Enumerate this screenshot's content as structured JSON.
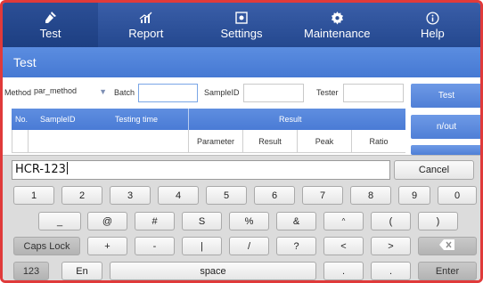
{
  "nav": {
    "items": [
      {
        "label": "Test",
        "icon": "flask-icon"
      },
      {
        "label": "Report",
        "icon": "chart-icon"
      },
      {
        "label": "Settings",
        "icon": "settings-icon"
      },
      {
        "label": "Maintenance",
        "icon": "gear-icon"
      },
      {
        "label": "Help",
        "icon": "info-icon"
      }
    ],
    "active": "Test"
  },
  "title": "Test",
  "filters": {
    "method_label": "Method",
    "method_value": "par_method",
    "batch_label": "Batch",
    "batch_value": "",
    "sampleid_label": "SampleID",
    "sampleid_value": "",
    "tester_label": "Tester",
    "tester_value": ""
  },
  "side_buttons": {
    "test": "Test",
    "n_out": "n/out"
  },
  "table": {
    "col_no": "No.",
    "col_sampleid": "SampleID",
    "col_testing_time": "Testing time",
    "col_result": "Result",
    "sub_columns": [
      "Parameter",
      "Result",
      "Peak",
      "Ratio"
    ]
  },
  "keyboard": {
    "input_value": "HCR-123",
    "cancel": "Cancel",
    "row1": [
      "1",
      "2",
      "3",
      "4",
      "5",
      "6",
      "7",
      "8",
      "9",
      "0"
    ],
    "row2": [
      "_",
      "@",
      "#",
      "S",
      "%",
      "&",
      "^",
      "(",
      ")"
    ],
    "caps_lock": "Caps Lock",
    "row3": [
      "+",
      "-",
      "|",
      "/",
      "?",
      "<",
      ">"
    ],
    "backspace_icon": "backspace-icon",
    "num_mode": "123",
    "lang": "En",
    "space": "space",
    "row4_extra": [
      ".",
      "."
    ],
    "enter": "Enter"
  },
  "colors": {
    "nav_bg": "#2f5399",
    "title_bg": "#4f82d8",
    "accent": "#5a8be0",
    "frame_border": "#e03a3a"
  }
}
